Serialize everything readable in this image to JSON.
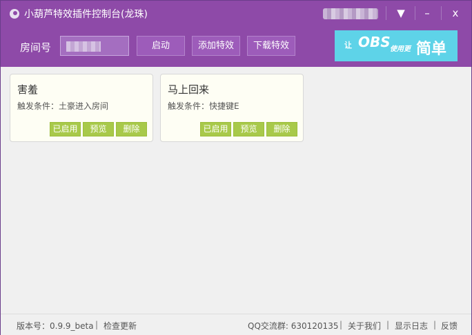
{
  "window": {
    "title": "小葫芦特效插件控制台(龙珠)"
  },
  "titlebar": {
    "menu_glyph": "▼",
    "minimize_glyph": "–",
    "close_glyph": "x"
  },
  "toolbar": {
    "room_label": "房间号",
    "room_input_value": "",
    "start_label": "启动",
    "add_effect_label": "添加特效",
    "download_effect_label": "下载特效",
    "banner": {
      "prefix": "让",
      "brand": "OBS",
      "middle": "使用更",
      "suffix": "简单"
    }
  },
  "cards": [
    {
      "name": "害羞",
      "condition": "触发条件：土豪进入房间",
      "enabled_label": "已启用",
      "preview_label": "预览",
      "delete_label": "删除"
    },
    {
      "name": "马上回来",
      "condition": "触发条件：快捷键E",
      "enabled_label": "已启用",
      "preview_label": "预览",
      "delete_label": "删除"
    }
  ],
  "statusbar": {
    "version": "版本号：0.9.9_beta",
    "check_update": "检查更新",
    "qq_group": "QQ交流群: 630120135",
    "about": "关于我们",
    "show_log": "显示日志",
    "feedback": "反馈",
    "separator": "|"
  },
  "colors": {
    "titlebar": "#8e4aa8",
    "card_button": "#a8c94a",
    "banner": "#5ed3e8"
  }
}
